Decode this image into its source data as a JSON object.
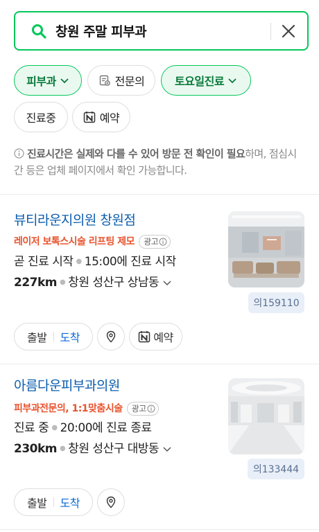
{
  "search": {
    "query": "창원 주말 피부과"
  },
  "filters": [
    {
      "label": "피부과",
      "active": true,
      "dropdown": true
    },
    {
      "label": "전문의",
      "active": false,
      "icon": "specialist-icon"
    },
    {
      "label": "토요일진료",
      "active": true,
      "dropdown": true
    },
    {
      "label": "진료중",
      "active": false
    },
    {
      "label": "예약",
      "active": false,
      "icon": "naver-booking-icon"
    }
  ],
  "notice": {
    "bold": "진료시간은 실제와 다를 수 있어 방문 전 확인이 필요",
    "rest": "하며, 점심시간 등은 업체 페이지에서 확인 가능합니다."
  },
  "results": [
    {
      "name": "뷰티라운지의원 창원점",
      "promo": "레이저 보톡스시술 리프팅 제모",
      "ad_label": "광고",
      "status": "곧 진료 시작",
      "hours": "15:00에 진료 시작",
      "distance": "227km",
      "address": "창원 성산구 상남동",
      "review_badge": "의159110",
      "actions": {
        "depart": "출발",
        "arrive": "도착",
        "reserve": "예약"
      }
    },
    {
      "name": "아름다운피부과의원",
      "promo": "피부과전문의, 1:1맞춤시술",
      "ad_label": "광고",
      "status": "진료 중",
      "hours": "20:00에 진료 종료",
      "distance": "230km",
      "address": "창원 성산구 대방동",
      "review_badge": "의133444",
      "actions": {
        "depart": "출발",
        "arrive": "도착"
      }
    }
  ],
  "colors": {
    "accent": "#03c75a",
    "link": "#0a5cad",
    "promo": "#e8532d"
  }
}
